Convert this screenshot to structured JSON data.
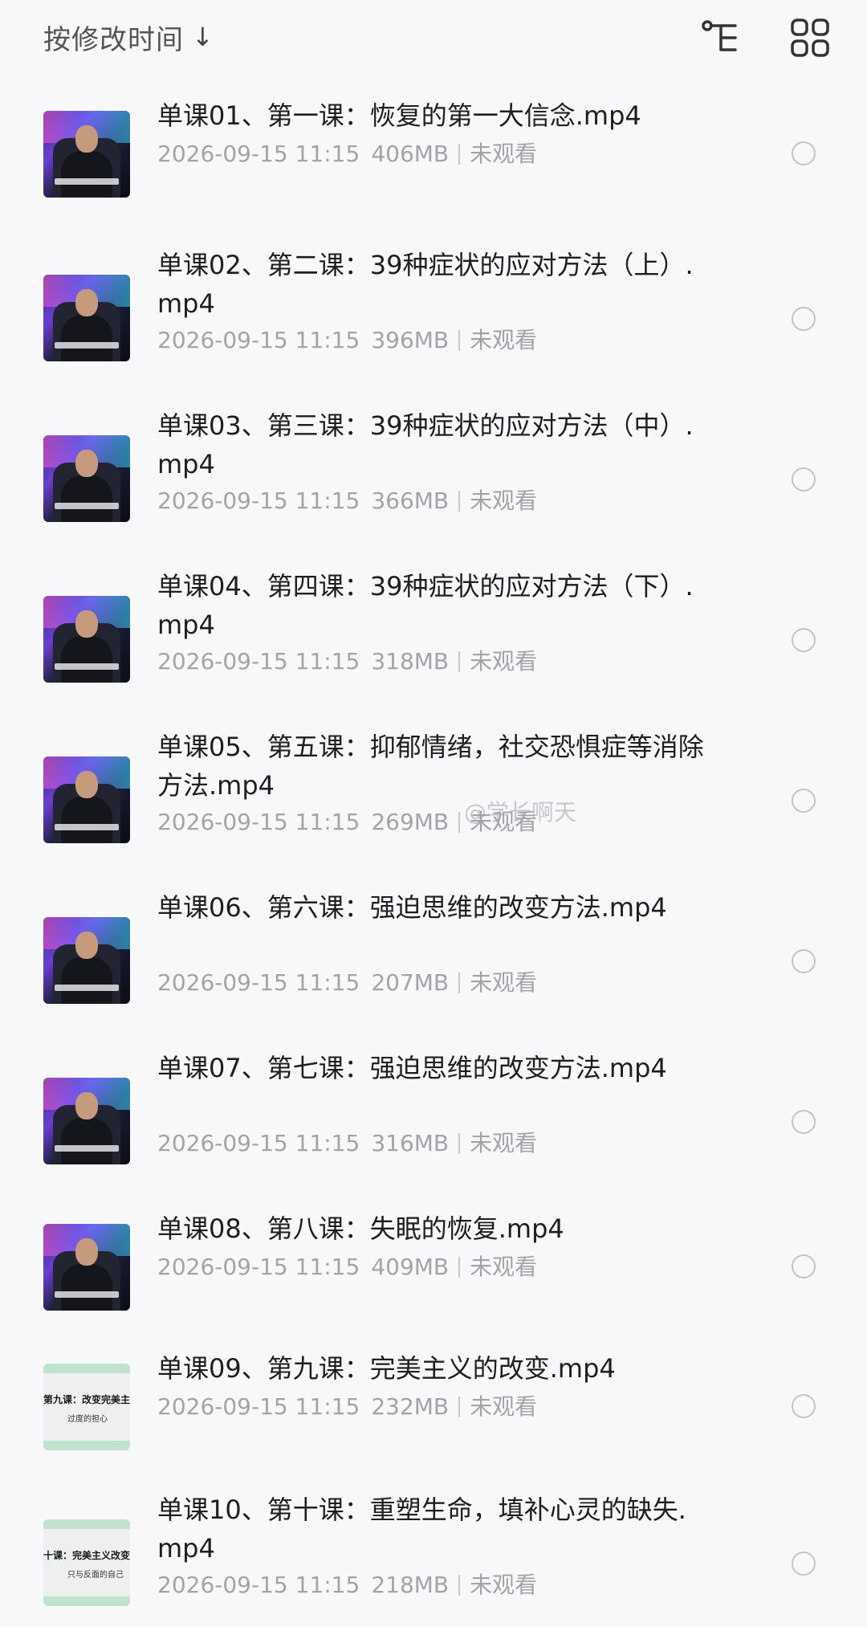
{
  "header": {
    "sort_label": "按修改时间",
    "sort_arrow": "↓",
    "icons": [
      "tree-view-icon",
      "grid-view-icon"
    ]
  },
  "watermark": "@学长啊天",
  "files": [
    {
      "title": "单课01、第一课：恢复的第一大信念.mp4",
      "date": "2026-09-15 11:15",
      "size": "406MB",
      "status": "未观看",
      "thumb": "video",
      "selected": false
    },
    {
      "title": "单课02、第二课：39种症状的应对方法（上）.mp4",
      "date": "2026-09-15 11:15",
      "size": "396MB",
      "status": "未观看",
      "thumb": "video",
      "selected": false
    },
    {
      "title": "单课03、第三课：39种症状的应对方法（中）.mp4",
      "date": "2026-09-15 11:15",
      "size": "366MB",
      "status": "未观看",
      "thumb": "video",
      "selected": false
    },
    {
      "title": "单课04、第四课：39种症状的应对方法（下）.mp4",
      "date": "2026-09-15 11:15",
      "size": "318MB",
      "status": "未观看",
      "thumb": "video",
      "selected": false
    },
    {
      "title": "单课05、第五课：抑郁情绪，社交恐惧症等消除方法.mp4",
      "date": "2026-09-15 11:15",
      "size": "269MB",
      "status": "未观看",
      "thumb": "video",
      "selected": false
    },
    {
      "title": "单课06、第六课：强迫思维的改变方法.mp4",
      "date": "2026-09-15 11:15",
      "size": "207MB",
      "status": "未观看",
      "thumb": "video",
      "selected": false
    },
    {
      "title": "单课07、第七课：强迫思维的改变方法.mp4",
      "date": "2026-09-15 11:15",
      "size": "316MB",
      "status": "未观看",
      "thumb": "video",
      "selected": false
    },
    {
      "title": "单课08、第八课：失眠的恢复.mp4",
      "date": "2026-09-15 11:15",
      "size": "409MB",
      "status": "未观看",
      "thumb": "video",
      "selected": false
    },
    {
      "title": "单课09、第九课：完美主义的改变.mp4",
      "date": "2026-09-15 11:15",
      "size": "232MB",
      "status": "未观看",
      "thumb": "slide",
      "slide_title": "第九课：改变完美主义",
      "slide_sub": "过度的担心",
      "selected": false
    },
    {
      "title": "单课10、第十课：重塑生命，填补心灵的缺失.mp4",
      "date": "2026-09-15 11:15",
      "size": "218MB",
      "status": "未观看",
      "thumb": "slide",
      "slide_title": "十课：完美主义改变方法",
      "slide_sub": "只与反面的自己",
      "selected": false
    }
  ]
}
